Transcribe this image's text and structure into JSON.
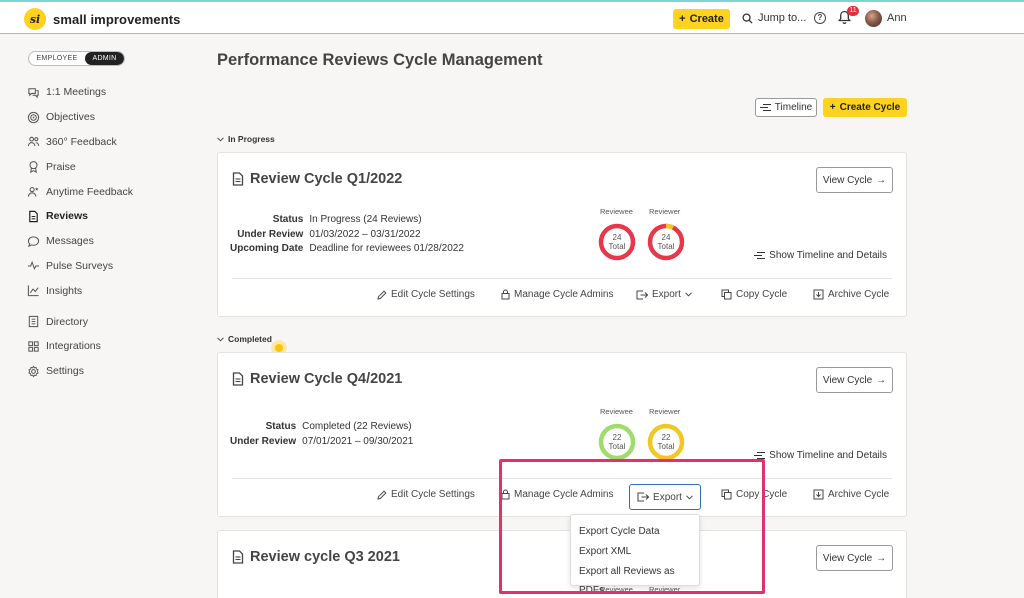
{
  "app": {
    "name": "small improvements",
    "logo_glyph": "si"
  },
  "topbar": {
    "create_label": "Create",
    "jump_label": "Jump to...",
    "notification_count": "11",
    "user_name": "Ann"
  },
  "role_toggle": {
    "employee": "EMPLOYEE",
    "admin": "ADMIN"
  },
  "sidebar": {
    "items": [
      {
        "label": "1:1 Meetings",
        "icon": "chat-icon"
      },
      {
        "label": "Objectives",
        "icon": "target-icon"
      },
      {
        "label": "360° Feedback",
        "icon": "people-icon"
      },
      {
        "label": "Praise",
        "icon": "award-icon"
      },
      {
        "label": "Anytime Feedback",
        "icon": "person-feedback-icon"
      },
      {
        "label": "Reviews",
        "icon": "document-icon",
        "active": true
      },
      {
        "label": "Messages",
        "icon": "message-icon"
      },
      {
        "label": "Pulse Surveys",
        "icon": "pulse-icon"
      },
      {
        "label": "Insights",
        "icon": "chart-icon"
      },
      {
        "label": "Directory",
        "icon": "directory-icon"
      },
      {
        "label": "Integrations",
        "icon": "grid-icon"
      },
      {
        "label": "Settings",
        "icon": "gear-icon"
      }
    ]
  },
  "page": {
    "title": "Performance Reviews Cycle Management",
    "timeline_label": "Timeline",
    "create_cycle_label": "Create Cycle"
  },
  "sections": {
    "in_progress": "In Progress",
    "completed": "Completed"
  },
  "labels": {
    "status": "Status",
    "under_review": "Under Review",
    "upcoming_date": "Upcoming Date",
    "reviewee": "Reviewee",
    "reviewer": "Reviewer",
    "total": "Total",
    "view_cycle": "View Cycle",
    "show_timeline": "Show Timeline and Details",
    "edit_settings": "Edit Cycle Settings",
    "manage_admins": "Manage Cycle Admins",
    "export": "Export",
    "copy_cycle": "Copy Cycle",
    "archive_cycle": "Archive Cycle"
  },
  "cycles": [
    {
      "title": "Review Cycle Q1/2022",
      "status": "In Progress (24 Reviews)",
      "under_review": "01/03/2022 – 03/31/2022",
      "upcoming_date": "Deadline for reviewees 01/28/2022",
      "reviewee_total": "24",
      "reviewer_total": "24",
      "reviewee_color": "#e8364b",
      "reviewer_color": "#e8364b",
      "reviewer_accent": "#f3c623"
    },
    {
      "title": "Review Cycle Q4/2021",
      "status": "Completed (22 Reviews)",
      "under_review": "07/01/2021 – 09/30/2021",
      "reviewee_total": "22",
      "reviewer_total": "22",
      "reviewee_color": "#9fdc6c",
      "reviewer_color": "#f3c623"
    },
    {
      "title": "Review cycle Q3 2021"
    }
  ],
  "export_menu": {
    "items": [
      "Export Cycle Data",
      "Export XML",
      "Export all Reviews as PDFs"
    ]
  },
  "colors": {
    "accent_yellow": "#ffd21f",
    "highlight": "#e3306e",
    "focus_blue": "#2e6fb8"
  }
}
